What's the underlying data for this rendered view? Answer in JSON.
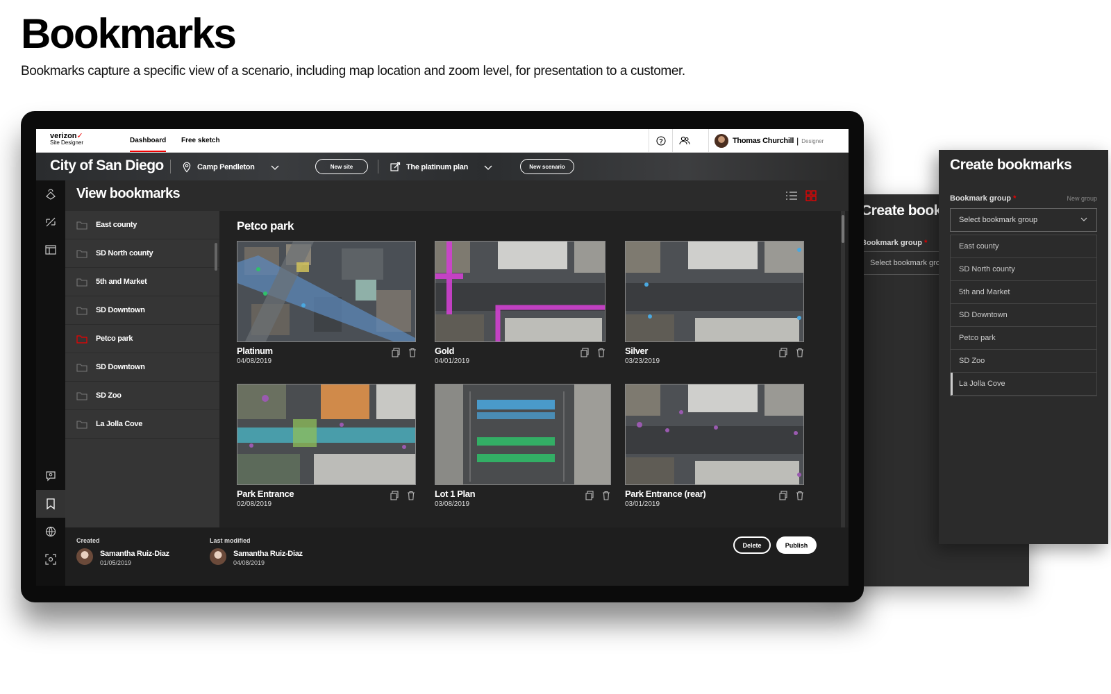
{
  "heading": {
    "title": "Bookmarks",
    "subtitle": "Bookmarks capture a specific view of a scenario, including map location and zoom level, for presentation to a customer."
  },
  "app": {
    "brand": "verizon",
    "brand_sub": "Site Designer",
    "nav_tabs": [
      "Dashboard",
      "Free sketch"
    ],
    "active_tab": "Dashboard",
    "user": {
      "name": "Thomas Churchill",
      "role": "Designer"
    },
    "city": "City of San Diego",
    "site": "Camp Pendleton",
    "new_site_label": "New site",
    "plan": "The platinum plan",
    "new_scenario_label": "New scenario",
    "view_title": "View bookmarks",
    "groups": [
      {
        "label": "East county",
        "active": false
      },
      {
        "label": "SD North county",
        "active": false
      },
      {
        "label": "5th and Market",
        "active": false
      },
      {
        "label": "SD Downtown",
        "active": false
      },
      {
        "label": "Petco park",
        "active": true
      },
      {
        "label": "SD Downtown",
        "active": false
      },
      {
        "label": "SD Zoo",
        "active": false
      },
      {
        "label": "La Jolla Cove",
        "active": false
      }
    ],
    "group_title": "Petco park",
    "bookmarks": [
      {
        "name": "Platinum",
        "date": "04/08/2019"
      },
      {
        "name": "Gold",
        "date": "04/01/2019"
      },
      {
        "name": "Silver",
        "date": "03/23/2019"
      },
      {
        "name": "Park Entrance",
        "date": "02/08/2019"
      },
      {
        "name": "Lot 1 Plan",
        "date": "03/08/2019"
      },
      {
        "name": "Park Entrance (rear)",
        "date": "03/01/2019"
      }
    ],
    "footer": {
      "created_label": "Created",
      "created_name": "Samantha Ruiz-Diaz",
      "created_date": "01/05/2019",
      "modified_label": "Last modified",
      "modified_name": "Samantha Ruiz-Diaz",
      "modified_date": "04/08/2019",
      "delete_label": "Delete",
      "publish_label": "Publish"
    }
  },
  "panel_back": {
    "title": "Create bookmarks",
    "label": "Bookmark group",
    "required_mark": "*",
    "placeholder": "Select bookmark group"
  },
  "panel_front": {
    "title": "Create bookmarks",
    "label": "Bookmark group",
    "required_mark": "*",
    "new_group_label": "New group",
    "placeholder": "Select bookmark group",
    "options": [
      "East county",
      "SD North county",
      "5th and Market",
      "SD Downtown",
      "Petco park",
      "SD Zoo",
      "La Jolla Cove"
    ],
    "highlighted_option": "La Jolla Cove"
  },
  "colors": {
    "accent": "#e00000",
    "route_pink": "#d040d0",
    "route_blue": "#4aa8e0",
    "dark_bg": "#2b2b2b"
  }
}
